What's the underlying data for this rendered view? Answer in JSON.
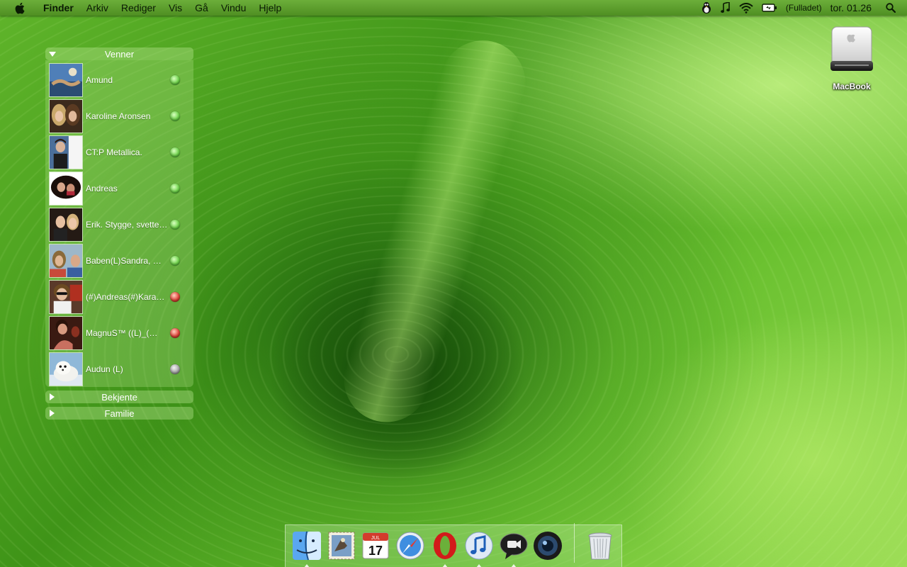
{
  "menubar": {
    "app_name": "Finder",
    "items": [
      "Arkiv",
      "Rediger",
      "Vis",
      "Gå",
      "Vindu",
      "Hjelp"
    ],
    "battery_label": "(Fulladet)",
    "clock": "tor. 01.26",
    "icons": [
      "apple-icon",
      "adium-duck-icon",
      "music-note-icon",
      "wifi-icon",
      "battery-icon",
      "spotlight-search-icon"
    ]
  },
  "desktop": {
    "drive_label": "MacBook"
  },
  "buddy_list": {
    "groups": [
      {
        "name": "Venner",
        "expanded": true,
        "buddies": [
          {
            "name": "Amund",
            "status_color": "#6fd34a"
          },
          {
            "name": "Karoline Aronsen",
            "status_color": "#6fd34a"
          },
          {
            "name": "CT:P   Metallica.",
            "status_color": "#6fd34a"
          },
          {
            "name": "Andreas",
            "status_color": "#6fd34a"
          },
          {
            "name": "Erik. Stygge, svette…",
            "status_color": "#6fd34a"
          },
          {
            "name": "Baben(L)Sandra, …",
            "status_color": "#6fd34a"
          },
          {
            "name": "(#)Andreas(#)Kara…",
            "status_color": "#e0463a"
          },
          {
            "name": "MagnuS™    ((L)_(…",
            "status_color": "#e0463a"
          },
          {
            "name": "Audun   (L)",
            "status_color": "#a9a9a9"
          }
        ]
      },
      {
        "name": "Bekjente",
        "expanded": false
      },
      {
        "name": "Familie",
        "expanded": false
      }
    ]
  },
  "dock": {
    "apps": [
      {
        "icon": "finder-icon",
        "running": true
      },
      {
        "icon": "mail-icon",
        "running": false
      },
      {
        "icon": "ical-icon",
        "running": false,
        "calendar_month": "JUL",
        "calendar_day": "17"
      },
      {
        "icon": "safari-icon",
        "running": false
      },
      {
        "icon": "opera-icon",
        "running": true
      },
      {
        "icon": "itunes-icon",
        "running": true
      },
      {
        "icon": "ichat-icon",
        "running": true
      },
      {
        "icon": "photo-booth-icon",
        "running": false
      }
    ],
    "trash_icon": "trash-icon"
  }
}
